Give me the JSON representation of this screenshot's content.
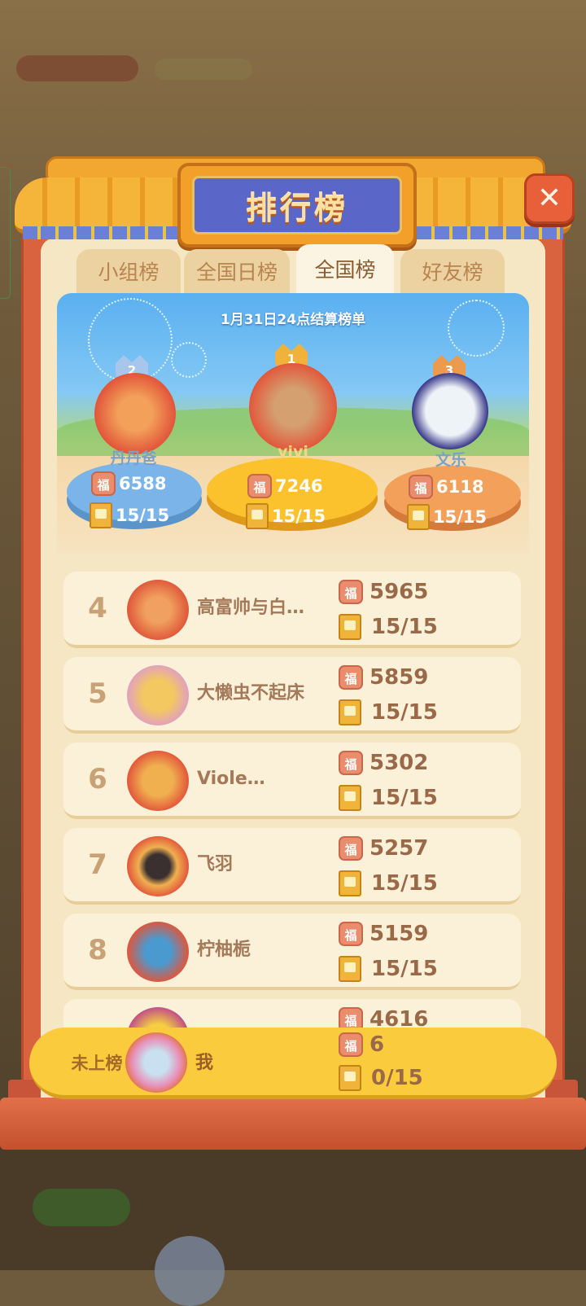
{
  "title": "排行榜",
  "tabs": [
    "小组榜",
    "全国日榜",
    "全国榜",
    "好友榜"
  ],
  "active_tab": "全国榜",
  "settlement_note": "1月31日24点结算榜单",
  "podium": [
    {
      "rank": "2",
      "name": "丹丹爸",
      "score": "6588",
      "progress": "15/15"
    },
    {
      "rank": "1",
      "name": "vivi",
      "score": "7246",
      "progress": "15/15"
    },
    {
      "rank": "3",
      "name": "文乐",
      "score": "6118",
      "progress": "15/15"
    }
  ],
  "rows": [
    {
      "rank": "4",
      "name": "高富帅与白…",
      "score": "5965",
      "progress": "15/15"
    },
    {
      "rank": "5",
      "name": "大懒虫不起床",
      "score": "5859",
      "progress": "15/15"
    },
    {
      "rank": "6",
      "name": "Viole…",
      "score": "5302",
      "progress": "15/15"
    },
    {
      "rank": "7",
      "name": "飞羽",
      "score": "5257",
      "progress": "15/15"
    },
    {
      "rank": "8",
      "name": "柠柚栀",
      "score": "5159",
      "progress": "15/15"
    },
    {
      "rank": "",
      "name": "",
      "score": "4616",
      "progress": ""
    }
  ],
  "me": {
    "rank": "未上榜",
    "name": "我",
    "score": "6",
    "progress": "0/15"
  },
  "icons": {
    "score": "fu-icon",
    "progress": "book-icon",
    "close": "close-icon"
  },
  "fu_glyph": "福",
  "close_glyph": "✕"
}
